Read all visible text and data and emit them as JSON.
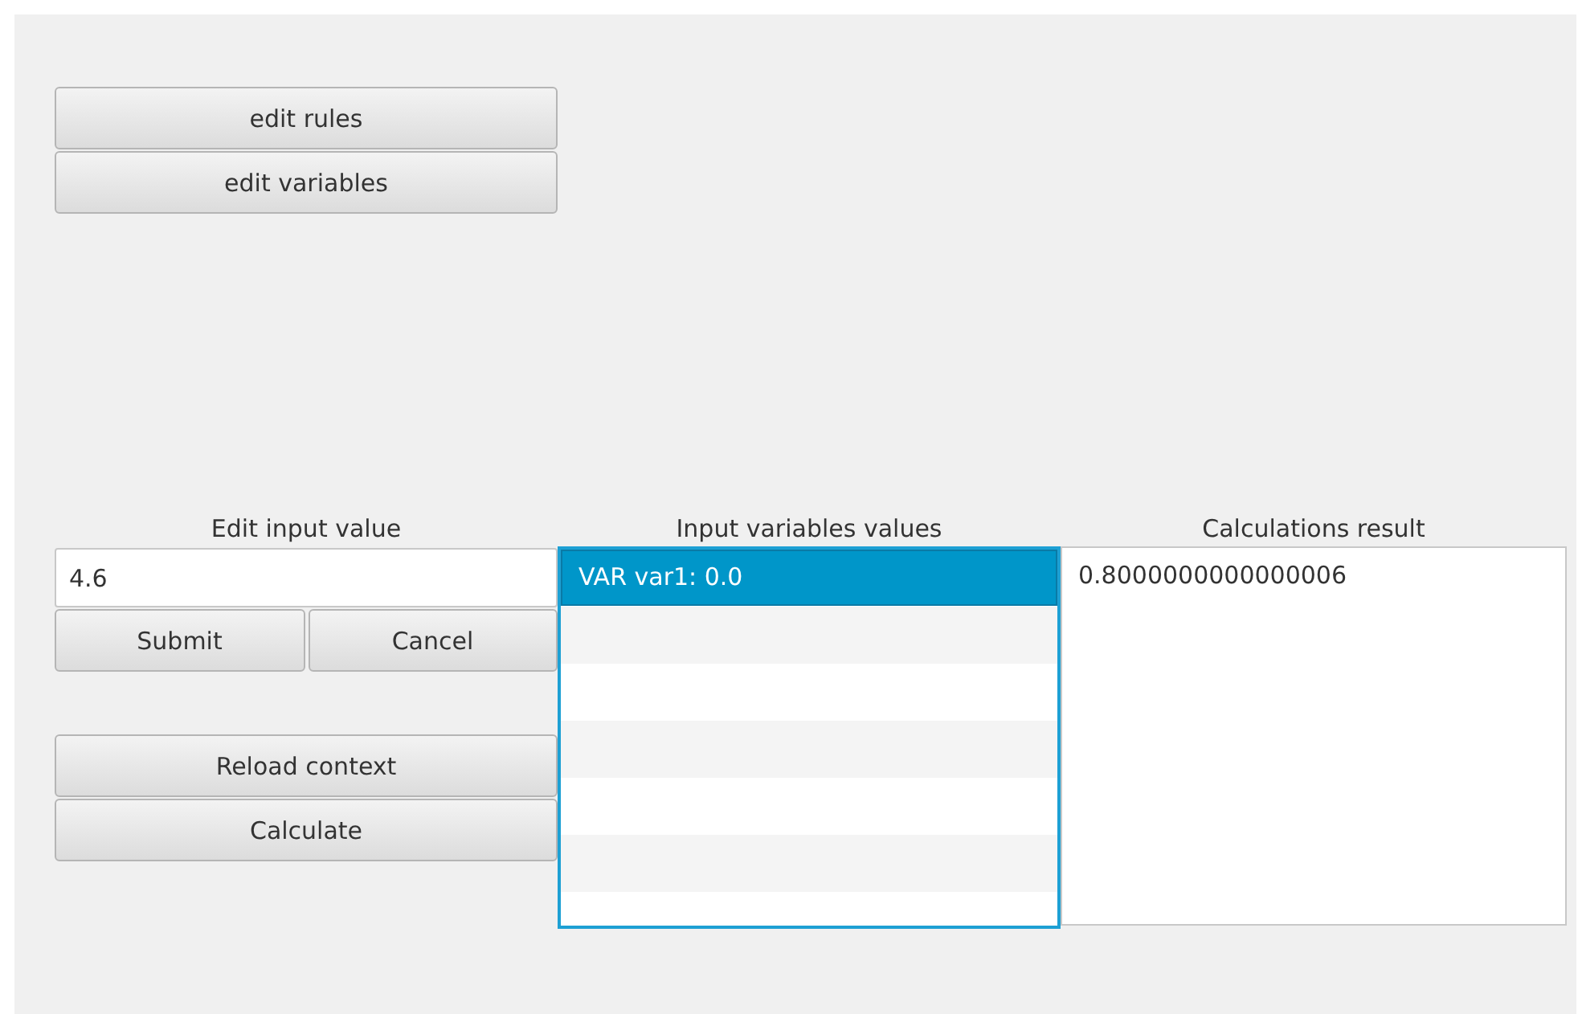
{
  "top_buttons": [
    {
      "label": "edit rules"
    },
    {
      "label": "edit variables"
    }
  ],
  "input_panel": {
    "heading": "Edit input value",
    "value": "4.6",
    "buttons": [
      {
        "label": "Submit"
      },
      {
        "label": "Cancel"
      }
    ]
  },
  "action_buttons": [
    {
      "label": "Reload context"
    },
    {
      "label": "Calculate"
    }
  ],
  "variables": {
    "heading": "Input variables values",
    "focused": true,
    "items": [
      {
        "label": "VAR var1: 0.0",
        "selected": true
      }
    ]
  },
  "results": {
    "heading": "Calculations result",
    "items": [
      {
        "label": "0.8000000000000006",
        "selected": false
      }
    ]
  }
}
